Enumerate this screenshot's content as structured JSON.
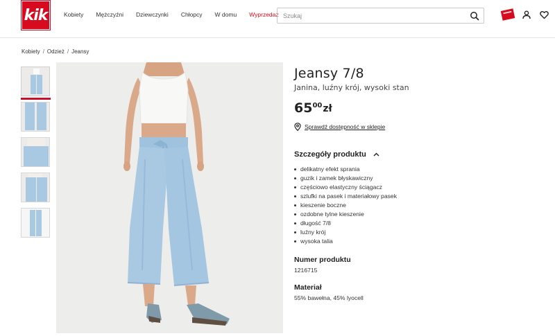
{
  "header": {
    "logo_text": "kik",
    "nav": [
      "Kobiety",
      "Mężczyźni",
      "Dziewczynki",
      "Chłopcy",
      "W domu",
      "Wyprzedaż"
    ],
    "search_placeholder": "Szukaj"
  },
  "breadcrumb": [
    "Kobiety",
    "Odzież",
    "Jeansy"
  ],
  "product": {
    "title": "Jeansy 7/8",
    "subtitle": "Janina, luźny krój, wysoki stan",
    "price_whole": "65",
    "price_cents": "00",
    "currency": "zł",
    "store_link": "Sprawdź dostępność w sklepie",
    "details_heading": "Szczegóły produktu",
    "features": [
      "delikatny efekt sprania",
      "guzik i zamek błyskawiczny",
      "częściowo elastyczny ściągacz",
      "szlufki na pasek i materiałowy pasek",
      "kieszenie boczne",
      "ozdobne tylne kieszenie",
      "długość 7/8",
      "luźny krój",
      "wysoka talia"
    ],
    "number_heading": "Numer produktu",
    "number_value": "1216715",
    "material_heading": "Materiał",
    "material_value": "55% bawełna, 45% lyocell"
  },
  "colors": {
    "brand": "#d60b1f",
    "denim": "#a9c9e3"
  },
  "icons": [
    "search-icon",
    "promo-icon",
    "user-icon",
    "heart-icon",
    "location-pin-icon",
    "chevron-up-icon"
  ]
}
